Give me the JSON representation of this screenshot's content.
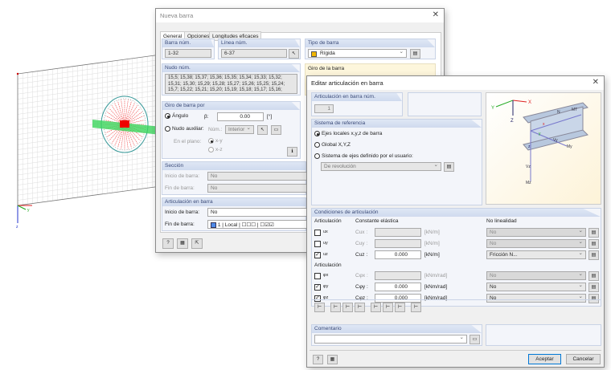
{
  "viewport": {
    "axis_y": "y",
    "axis_z": "z"
  },
  "nueva_barra": {
    "title": "Nueva barra",
    "tabs": [
      "General",
      "Opciones",
      "Longitudes eficaces"
    ],
    "barra_num": {
      "label": "Barra núm.",
      "value": "1-32"
    },
    "linea_num": {
      "label": "Línea núm.",
      "value": "6-37"
    },
    "tipo_barra": {
      "label": "Tipo de barra",
      "value": "Rígida",
      "color": "#f2b600"
    },
    "nudo_num": {
      "label": "Nudo núm.",
      "value": "15,5; 15,38; 15,37; 15,36; 15,35; 15,34; 15,33; 15,32; 15,31; 15,30; 15,29; 15,28; 15,27; 15,26; 15,25; 15,24; 15,7; 15,22; 15,21; 15,20; 15,19; 15,18; 15,17; 15,16;"
    },
    "giro_barra": {
      "label": "Giro de la barra"
    },
    "giro_por": {
      "label": "Giro de barra por",
      "angulo": "Ángulo",
      "beta": "β:",
      "beta_value": "0.00",
      "unit": "[°]",
      "nudo_aux": "Nudo auxiliar:",
      "num": "Núm.:",
      "num_value": "Interior",
      "en_plano": "En el plano:",
      "opt1": "x-y",
      "opt2": "x-z"
    },
    "seccion": {
      "label": "Sección",
      "inicio": "Inicio de barra:",
      "inicio_value": "No",
      "fin": "Fin de barra:",
      "fin_value": "No"
    },
    "articulacion": {
      "label": "Articulación en barra",
      "inicio": "Inicio de barra:",
      "inicio_value": "No",
      "fin": "Fin de barra:",
      "fin_num": "1",
      "fin_sys": "Local",
      "fin_color": "#4f8ae8"
    }
  },
  "editar": {
    "title": "Editar articulación en barra",
    "num": {
      "label": "Articulación en barra núm.",
      "value": "1"
    },
    "sistema": {
      "label": "Sistema de referencia",
      "opt1": "Ejes locales x,y,z de barra",
      "opt2": "Global X,Y,Z",
      "opt3": "Sistema de ejes definido por el usuario:",
      "user_value": "De revolución"
    },
    "image_labels": {
      "X": "X",
      "Y": "Y",
      "Z": "Z",
      "x": "x",
      "y": "y",
      "z": "z",
      "N": "N",
      "MT": "MT",
      "Vy": "Vy",
      "My": "My",
      "Vz": "Vz",
      "Mz": "Mz"
    },
    "condiciones": {
      "label": "Condiciones de articulación",
      "col_art": "Articulación",
      "col_const": "Constante elástica",
      "col_nolin": "No linealidad",
      "trans": [
        {
          "name": "ux",
          "checked": false,
          "c": "Cux :",
          "value": "",
          "unit": "[kN/m]",
          "nolin": "No",
          "enabled": false
        },
        {
          "name": "uy",
          "checked": false,
          "c": "Cuy :",
          "value": "",
          "unit": "[kN/m]",
          "nolin": "No",
          "enabled": false
        },
        {
          "name": "uz",
          "checked": true,
          "c": "Cuz :",
          "value": "0.000",
          "unit": "[kN/m]",
          "nolin": "Fricción N...",
          "enabled": true
        }
      ],
      "rot_label": "Articulación",
      "rot": [
        {
          "name": "φx",
          "checked": false,
          "c": "Cφx :",
          "value": "",
          "unit": "[kNm/rad]",
          "nolin": "No",
          "enabled": false
        },
        {
          "name": "φy",
          "checked": true,
          "c": "Cφy :",
          "value": "0.000",
          "unit": "[kNm/rad]",
          "nolin": "No",
          "enabled": true
        },
        {
          "name": "φz",
          "checked": true,
          "c": "Cφz :",
          "value": "0.000",
          "unit": "[kNm/rad]",
          "nolin": "No",
          "enabled": true
        }
      ]
    },
    "comentario": {
      "label": "Comentario",
      "value": ""
    },
    "aceptar": "Aceptar",
    "cancelar": "Cancelar"
  }
}
